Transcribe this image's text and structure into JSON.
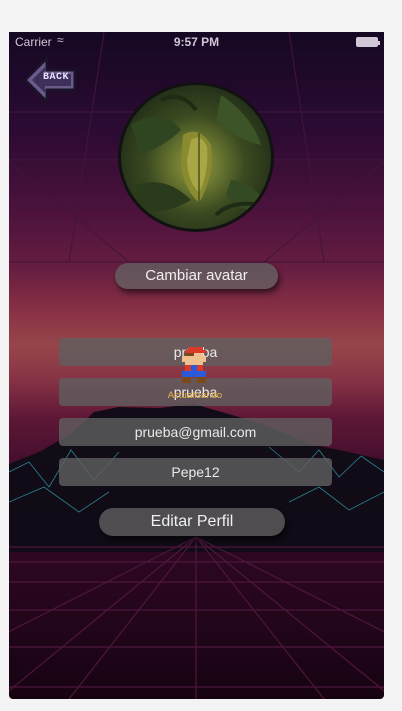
{
  "status_bar": {
    "carrier": "Carrier",
    "time": "9:57 PM"
  },
  "back_button": {
    "label": "BACK"
  },
  "change_avatar": {
    "label": "Cambiar avatar"
  },
  "fields": [
    {
      "value": "prueba"
    },
    {
      "value": "prueba"
    },
    {
      "value": "prueba@gmail.com"
    },
    {
      "value": "Pepe12"
    }
  ],
  "loading": {
    "label": "Actualizando"
  },
  "edit_profile": {
    "label": "Editar Perfil"
  },
  "colors": {
    "background_top": "#1c0b2f",
    "background_mid": "#c85e63",
    "grid_cyan": "#3fd7e6",
    "loader_text": "#e7b64a"
  }
}
